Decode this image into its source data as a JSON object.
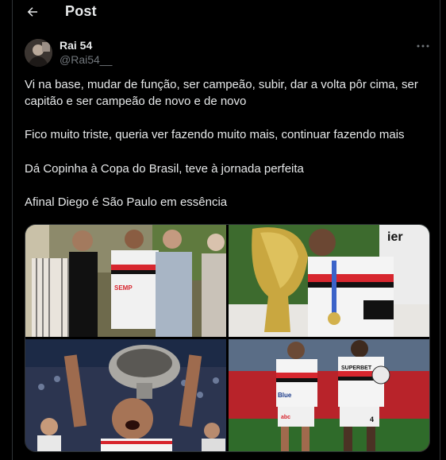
{
  "header": {
    "title": "Post",
    "back_icon": "arrow-left-icon"
  },
  "author": {
    "display_name": "Rai 54",
    "handle": "@Rai54__"
  },
  "post": {
    "paragraphs": [
      "Vi na base, mudar de função, ser campeão, subir, dar a volta pôr cima, ser capitão e ser campeão de novo e de novo",
      "Fico muito triste, queria ver fazendo muito mais, continuar fazendo mais",
      "Dá Copinha à Copa do Brasil, teve à jornada perfeita",
      "Afinal Diego é São Paulo em essência"
    ]
  },
  "media": {
    "count": 4,
    "jersey_texts": {
      "kit_sponsor": "SEMP",
      "banner": "ier",
      "shirt_sponsor_1": "Blue",
      "shirt_sponsor_2": "abc",
      "shirt_sponsor_3": "SUPERBET",
      "shirt_number": "4"
    }
  },
  "colors": {
    "background": "#000000",
    "text": "#e7e9ea",
    "secondary": "#71767b",
    "border": "#2f3336",
    "club_red": "#d7262e"
  }
}
